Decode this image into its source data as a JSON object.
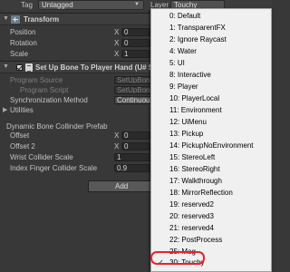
{
  "tagbar": {
    "tag_label": "Tag",
    "tag_value": "Untagged",
    "layer_label": "Layer",
    "layer_value": "Touchy"
  },
  "transform": {
    "title": "Transform",
    "rows": [
      {
        "label": "Position",
        "x": "0"
      },
      {
        "label": "Rotation",
        "x": "0"
      },
      {
        "label": "Scale",
        "x": "1"
      }
    ]
  },
  "script_component": {
    "title": "Set Up Bone To Player Hand (U# Script)",
    "program_source_label": "Program Source",
    "program_source_value": "SetUpBon",
    "program_script_label": "Program Script",
    "program_script_value": "SetUpBon",
    "sync_label": "Synchronization Method",
    "sync_value": "Continuous",
    "utilities_label": "Utilities",
    "collider_prefab_label": "Dynamic Bone Collinder Prefab",
    "offset_label": "Offset",
    "offset_x": "0",
    "offset2_label": "Offset 2",
    "offset2_x": "0",
    "wrist_label": "Wrist Collider Scale",
    "wrist_value": "1",
    "index_label": "Index Finger Collider Scale",
    "index_value": "0.9"
  },
  "add_component_label": "Add Component",
  "layer_menu": {
    "items": [
      "0: Default",
      "1: TransparentFX",
      "2: Ignore Raycast",
      "4: Water",
      "5: UI",
      "8: Interactive",
      "9: Player",
      "10: PlayerLocal",
      "11: Environment",
      "12: UiMenu",
      "13: Pickup",
      "14: PickupNoEnvironment",
      "15: StereoLeft",
      "16: StereoRight",
      "17: Walkthrough",
      "18: MirrorReflection",
      "19: reserved2",
      "20: reserved3",
      "21: reserved4",
      "22: PostProcess",
      "25: Mag",
      "30: Touchy"
    ],
    "checkmark": "✓",
    "selected_item": "30: Touchy"
  }
}
